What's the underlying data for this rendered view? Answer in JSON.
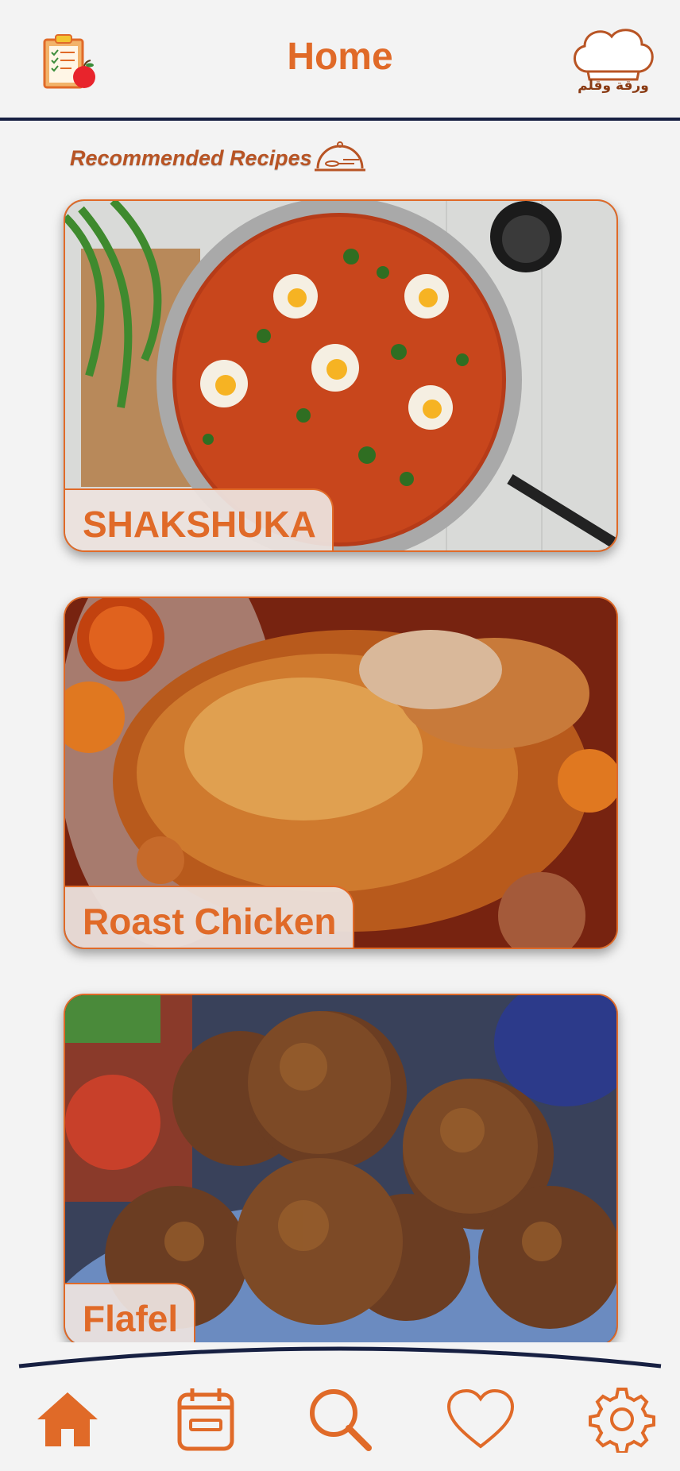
{
  "header": {
    "title": "Home",
    "left_icon": "clipboard-checklist-apple-icon",
    "logo_icon": "chef-hat-icon",
    "brand_text": "ورقة وقلم"
  },
  "recommended": {
    "title": "Recommended Recipes",
    "icon": "dish-cloche-icon"
  },
  "recipes": [
    {
      "name": "SHAKSHUKA",
      "image": "shakshuka-pan-photo"
    },
    {
      "name": "Roast Chicken",
      "image": "roast-chicken-photo"
    },
    {
      "name": "Flafel",
      "image": "falafel-photo"
    }
  ],
  "bottom_nav": {
    "items": [
      {
        "icon": "home-icon",
        "active": true
      },
      {
        "icon": "calendar-icon",
        "active": false
      },
      {
        "icon": "search-icon",
        "active": false
      },
      {
        "icon": "heart-icon",
        "active": false
      },
      {
        "icon": "gear-icon",
        "active": false
      }
    ]
  },
  "colors": {
    "accent": "#e06a28",
    "navy": "#172042",
    "background": "#f3f3f3"
  }
}
